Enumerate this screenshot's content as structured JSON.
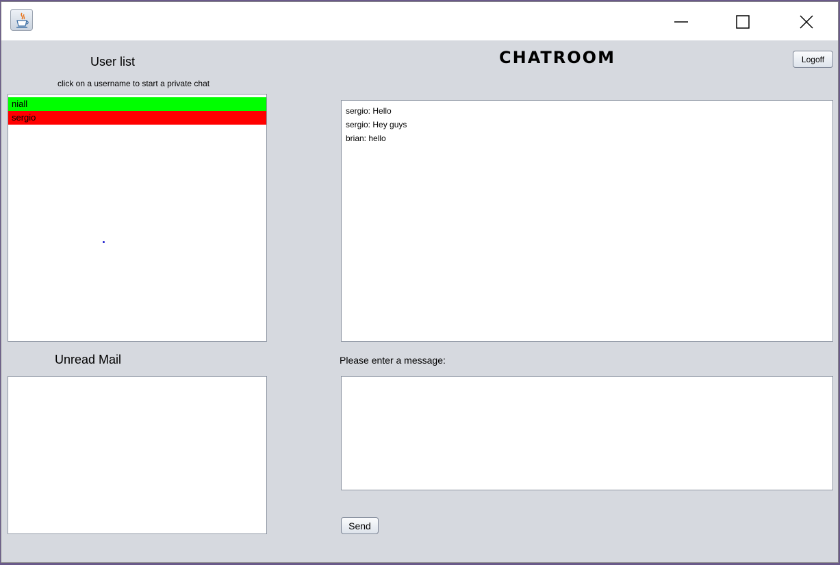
{
  "titlebar": {
    "icon": "java-coffee-icon",
    "controls": [
      "minimize-icon",
      "maximize-icon",
      "close-icon"
    ]
  },
  "user_panel": {
    "title": "User list",
    "hint": "click on a username to start a private chat",
    "users": [
      {
        "name": "niall",
        "color": "#00ff00"
      },
      {
        "name": "sergio",
        "color": "#ff0000"
      }
    ]
  },
  "unread_panel": {
    "title": "Unread Mail"
  },
  "chat": {
    "title": "CHATROOM",
    "logoff_label": "Logoff",
    "messages": [
      "sergio: Hello",
      "sergio: Hey guys",
      "brian: hello"
    ],
    "prompt": "Please enter a message:",
    "input_value": "",
    "send_label": "Send"
  }
}
